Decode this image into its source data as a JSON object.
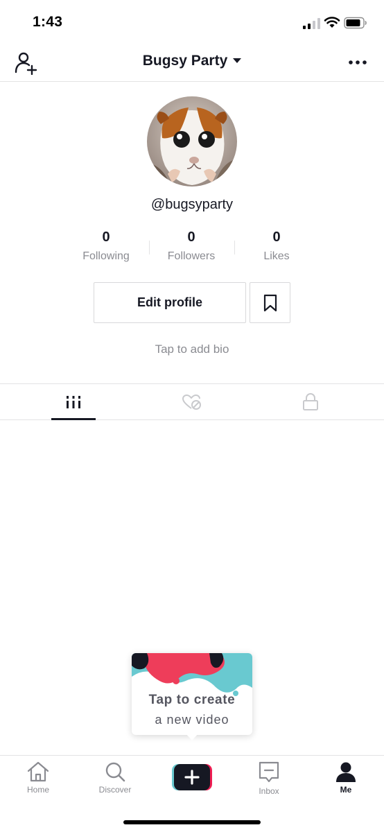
{
  "status_bar": {
    "time": "1:43"
  },
  "header": {
    "title": "Bugsy Party"
  },
  "profile": {
    "username": "@bugsyparty",
    "bio_placeholder": "Tap to add bio"
  },
  "stats": [
    {
      "value": "0",
      "label": "Following"
    },
    {
      "value": "0",
      "label": "Followers"
    },
    {
      "value": "0",
      "label": "Likes"
    }
  ],
  "actions": {
    "edit_profile": "Edit profile"
  },
  "tabs": [
    {
      "icon": "videos-grid-icon",
      "active": true
    },
    {
      "icon": "liked-hidden-icon",
      "active": false
    },
    {
      "icon": "lock-icon",
      "active": false
    }
  ],
  "create_tooltip": {
    "line1": "Tap to create",
    "line2": "a new video"
  },
  "bottom_nav": {
    "items": [
      {
        "label": "Home",
        "icon": "home-icon"
      },
      {
        "label": "Discover",
        "icon": "search-icon"
      },
      {
        "label": "",
        "icon": "plus-icon"
      },
      {
        "label": "Inbox",
        "icon": "inbox-icon"
      },
      {
        "label": "Me",
        "icon": "person-icon",
        "active": true
      }
    ]
  },
  "colors": {
    "text": "#161823",
    "secondary": "#8a8b91",
    "accent_red": "#ee1d52",
    "accent_cyan": "#69c9d0"
  }
}
